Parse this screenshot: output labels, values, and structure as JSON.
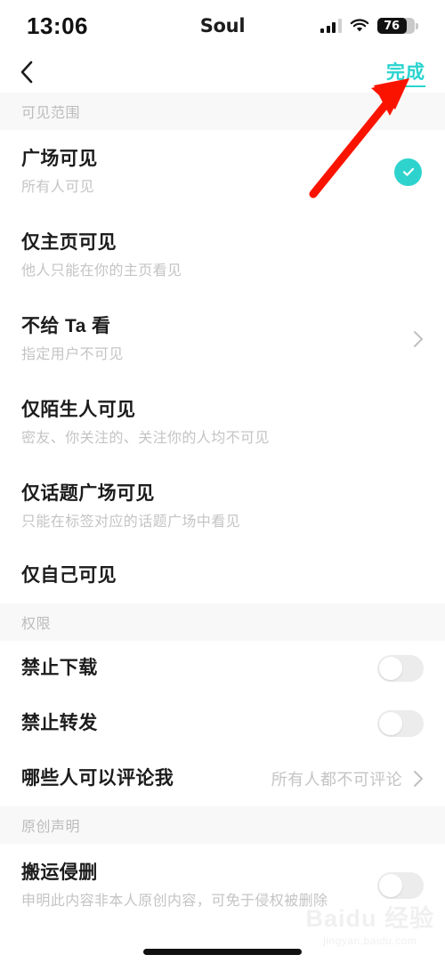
{
  "status_bar": {
    "time": "13:06",
    "carrier": "Soul",
    "battery_percent": "76",
    "signal_icon": "signal-bars-icon",
    "wifi_icon": "wifi-icon",
    "battery_icon": "battery-icon"
  },
  "nav": {
    "back_icon": "chevron-left-icon",
    "done_label": "完成"
  },
  "accent_color": "#2fd3cd",
  "sections": [
    {
      "header": "可见范围",
      "items": [
        {
          "title": "广场可见",
          "desc": "所有人可见",
          "control": "check",
          "selected": true
        },
        {
          "title": "仅主页可见",
          "desc": "他人只能在你的主页看见",
          "control": "none"
        },
        {
          "title": "不给 Ta 看",
          "desc": "指定用户不可见",
          "control": "chevron"
        },
        {
          "title": "仅陌生人可见",
          "desc": "密友、你关注的、关注你的人均不可见",
          "control": "none"
        },
        {
          "title": "仅话题广场可见",
          "desc": "只能在标签对应的话题广场中看见",
          "control": "none"
        },
        {
          "title": "仅自己可见",
          "desc": "",
          "control": "none"
        }
      ]
    },
    {
      "header": "权限",
      "items": [
        {
          "title": "禁止下载",
          "desc": "",
          "control": "toggle",
          "on": false
        },
        {
          "title": "禁止转发",
          "desc": "",
          "control": "toggle",
          "on": false
        },
        {
          "title": "哪些人可以评论我",
          "desc": "",
          "control": "chevron",
          "value": "所有人都不可评论"
        }
      ]
    },
    {
      "header": "原创声明",
      "items": [
        {
          "title": "搬运侵删",
          "desc": "申明此内容非本人原创内容，可免于侵权被删除",
          "control": "toggle",
          "on": false
        }
      ]
    }
  ],
  "annotation": {
    "arrow_color": "#fa1400",
    "arrow_target": "完成"
  },
  "watermark": {
    "main": "Baidu 经验",
    "sub": "jingyan.baidu.com"
  }
}
